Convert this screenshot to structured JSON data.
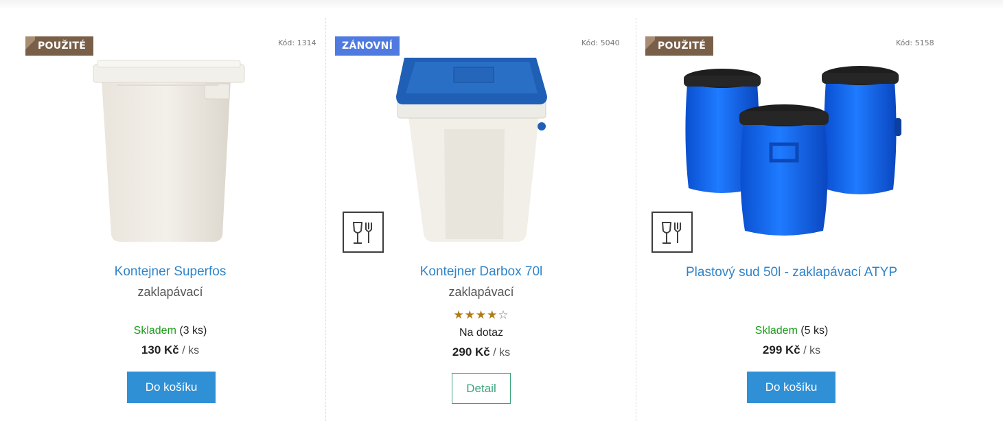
{
  "products": [
    {
      "flag": "POUŽITÉ",
      "code": "Kód: 1314",
      "name": "Kontejner Superfos",
      "subtitle": "zaklapávací",
      "stock_status": "Skladem",
      "stock_qty": "(3 ks)",
      "price": "130 Kč",
      "unit": "/ ks",
      "button": "Do košíku",
      "image": "white-square-container"
    },
    {
      "flag": "ZÁNOVNÍ",
      "code": "Kód: 5040",
      "name": "Kontejner Darbox 70l",
      "subtitle": "zaklapávací",
      "rating": 4,
      "rating_max": 5,
      "stock_status": "Na dotaz",
      "price": "290 Kč",
      "unit": "/ ks",
      "button": "Detail",
      "image": "white-container-blue-lid",
      "badge_icon": "food-safe-icon"
    },
    {
      "flag": "POUŽITÉ",
      "code": "Kód: 5158",
      "name": "Plastový sud 50l - zaklapávací ATYP",
      "stock_status": "Skladem",
      "stock_qty": "(5 ks)",
      "price": "299 Kč",
      "unit": "/ ks",
      "button": "Do košíku",
      "image": "blue-barrels",
      "badge_icon": "food-safe-icon"
    }
  ],
  "colors": {
    "flag_used": "#7a5f48",
    "flag_renewed": "#4f7ae0",
    "link": "#2f84c9",
    "in_stock": "#1c9b1c",
    "cart_button": "#2f90d6",
    "detail_button": "#3aa37a"
  }
}
